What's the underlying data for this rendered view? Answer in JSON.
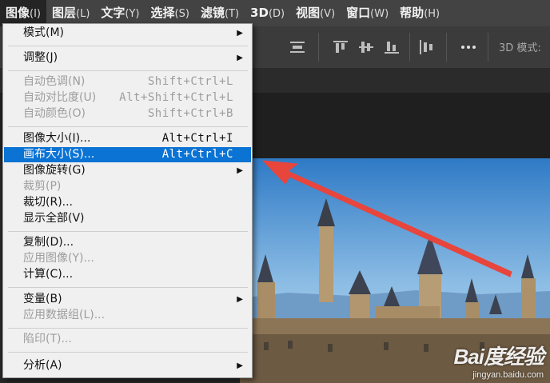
{
  "menubar": {
    "items": [
      {
        "label": "图像",
        "accel": "(I)"
      },
      {
        "label": "图层",
        "accel": "(L)"
      },
      {
        "label": "文字",
        "accel": "(Y)"
      },
      {
        "label": "选择",
        "accel": "(S)"
      },
      {
        "label": "滤镜",
        "accel": "(T)"
      },
      {
        "label": "3D",
        "accel": "(D)"
      },
      {
        "label": "视图",
        "accel": "(V)"
      },
      {
        "label": "窗口",
        "accel": "(W)"
      },
      {
        "label": "帮助",
        "accel": "(H)"
      }
    ]
  },
  "toolbar": {
    "mode_label": "3D 模式:",
    "icons": [
      "align-distribute-icon",
      "align-top-icon",
      "align-vcenter-icon",
      "align-bottom-icon",
      "align-left-icon",
      "more-options-icon"
    ]
  },
  "image_menu": {
    "items": [
      {
        "label": "模式(M)",
        "shortcut": "",
        "submenu": true,
        "disabled": false,
        "highlight": false
      },
      {
        "label": "调整(J)",
        "shortcut": "",
        "submenu": true,
        "disabled": false,
        "highlight": false
      },
      {
        "label": "自动色调(N)",
        "shortcut": "Shift+Ctrl+L",
        "submenu": false,
        "disabled": true,
        "highlight": false
      },
      {
        "label": "自动对比度(U)",
        "shortcut": "Alt+Shift+Ctrl+L",
        "submenu": false,
        "disabled": true,
        "highlight": false
      },
      {
        "label": "自动颜色(O)",
        "shortcut": "Shift+Ctrl+B",
        "submenu": false,
        "disabled": true,
        "highlight": false
      },
      {
        "label": "图像大小(I)...",
        "shortcut": "Alt+Ctrl+I",
        "submenu": false,
        "disabled": false,
        "highlight": false
      },
      {
        "label": "画布大小(S)...",
        "shortcut": "Alt+Ctrl+C",
        "submenu": false,
        "disabled": false,
        "highlight": true
      },
      {
        "label": "图像旋转(G)",
        "shortcut": "",
        "submenu": true,
        "disabled": false,
        "highlight": false
      },
      {
        "label": "裁剪(P)",
        "shortcut": "",
        "submenu": false,
        "disabled": true,
        "highlight": false
      },
      {
        "label": "裁切(R)...",
        "shortcut": "",
        "submenu": false,
        "disabled": false,
        "highlight": false
      },
      {
        "label": "显示全部(V)",
        "shortcut": "",
        "submenu": false,
        "disabled": false,
        "highlight": false
      },
      {
        "label": "复制(D)...",
        "shortcut": "",
        "submenu": false,
        "disabled": false,
        "highlight": false
      },
      {
        "label": "应用图像(Y)...",
        "shortcut": "",
        "submenu": false,
        "disabled": true,
        "highlight": false
      },
      {
        "label": "计算(C)...",
        "shortcut": "",
        "submenu": false,
        "disabled": false,
        "highlight": false
      },
      {
        "label": "变量(B)",
        "shortcut": "",
        "submenu": true,
        "disabled": false,
        "highlight": false
      },
      {
        "label": "应用数据组(L)...",
        "shortcut": "",
        "submenu": false,
        "disabled": true,
        "highlight": false
      },
      {
        "label": "陷印(T)...",
        "shortcut": "",
        "submenu": false,
        "disabled": true,
        "highlight": false
      },
      {
        "label": "分析(A)",
        "shortcut": "",
        "submenu": true,
        "disabled": false,
        "highlight": false
      }
    ]
  },
  "watermark": {
    "main": "Bai度经验",
    "sub": "jingyan.baidu.com"
  },
  "colors": {
    "menubar_bg": "#434343",
    "menu_bg": "#f0f0f0",
    "highlight": "#0a73d4",
    "disabled_text": "#9d9d9d",
    "arrow": "#e8453c"
  }
}
